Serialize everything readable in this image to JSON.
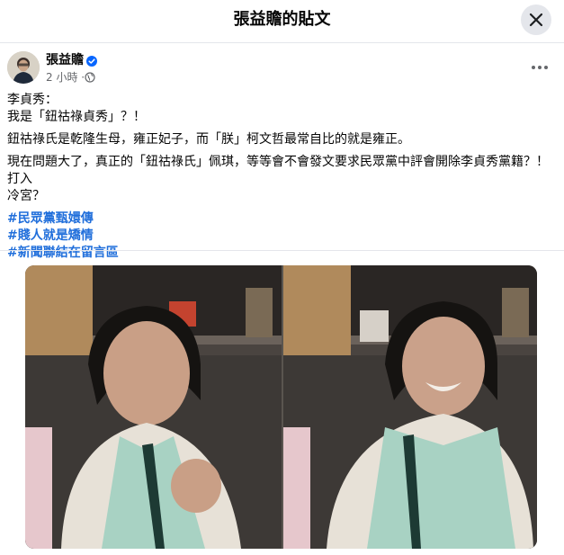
{
  "header": {
    "title": "張益贍的貼文"
  },
  "post": {
    "author": "張益贍",
    "time": "2 小時 ·",
    "lines": [
      "李貞秀：",
      "我是「鈕祜祿貞秀」？！",
      "鈕祜祿氏是乾隆生母，雍正妃子，而「朕」柯文哲最常自比的就是雍正。",
      "現在問題大了，真正的「鈕祜祿氏」佩琪，等等會不會發文要求民眾黨中評會開除李貞秀黨籍？！打入",
      "冷宮？"
    ],
    "hashtags": [
      "#民眾黨甄嬛傳",
      "#賤人就是矯情",
      "#新聞聯結在留言區"
    ]
  },
  "icons": {
    "close": "close-icon",
    "verified": "verified-badge-icon",
    "privacy": "public-globe-icon",
    "more": "more-options-icon"
  },
  "colors": {
    "hashtag": "#216fdb",
    "verified": "#0866ff",
    "secondary_text": "#65676b"
  }
}
